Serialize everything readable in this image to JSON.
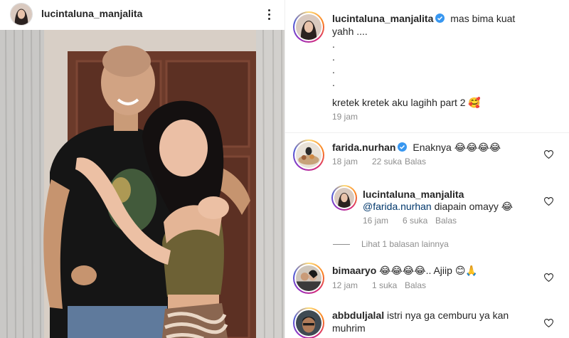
{
  "post": {
    "username": "lucintaluna_manjalita",
    "photo_alt": "Couple photo"
  },
  "caption": {
    "username": "lucintaluna_manjalita",
    "line1": "mas bima kuat",
    "line2": "yahh ....",
    "dots": [
      ".",
      ".",
      ".",
      "."
    ],
    "line_last": "kretek kretek aku lagihh part 2 🥰",
    "time": "19 jam"
  },
  "comments": [
    {
      "username": "farida.nurhan",
      "verified": true,
      "text": "Enaknya 😂😂😂😂",
      "time": "18 jam",
      "likes": "22 suka",
      "reply_label": "Balas"
    },
    {
      "username": "lucintaluna_manjalita",
      "mention": "@farida.nurhan",
      "text": "diapain omayy 😂",
      "time": "16 jam",
      "likes": "6 suka",
      "reply_label": "Balas"
    },
    {
      "username": "bimaaryo",
      "text": "😂😂😂😂.. Ajiip 😊🙏",
      "time": "12 jam",
      "likes": "1 suka",
      "reply_label": "Balas"
    },
    {
      "username": "abbduljalal",
      "text_line1": "istri nya ga cemburu ya kan",
      "text_line2": "muhrim"
    }
  ],
  "view_more_replies": "Lihat 1 balasan lainnya",
  "colors": {
    "verified": "#3897f0",
    "mention": "#00376b",
    "meta": "#8e8e8e"
  }
}
